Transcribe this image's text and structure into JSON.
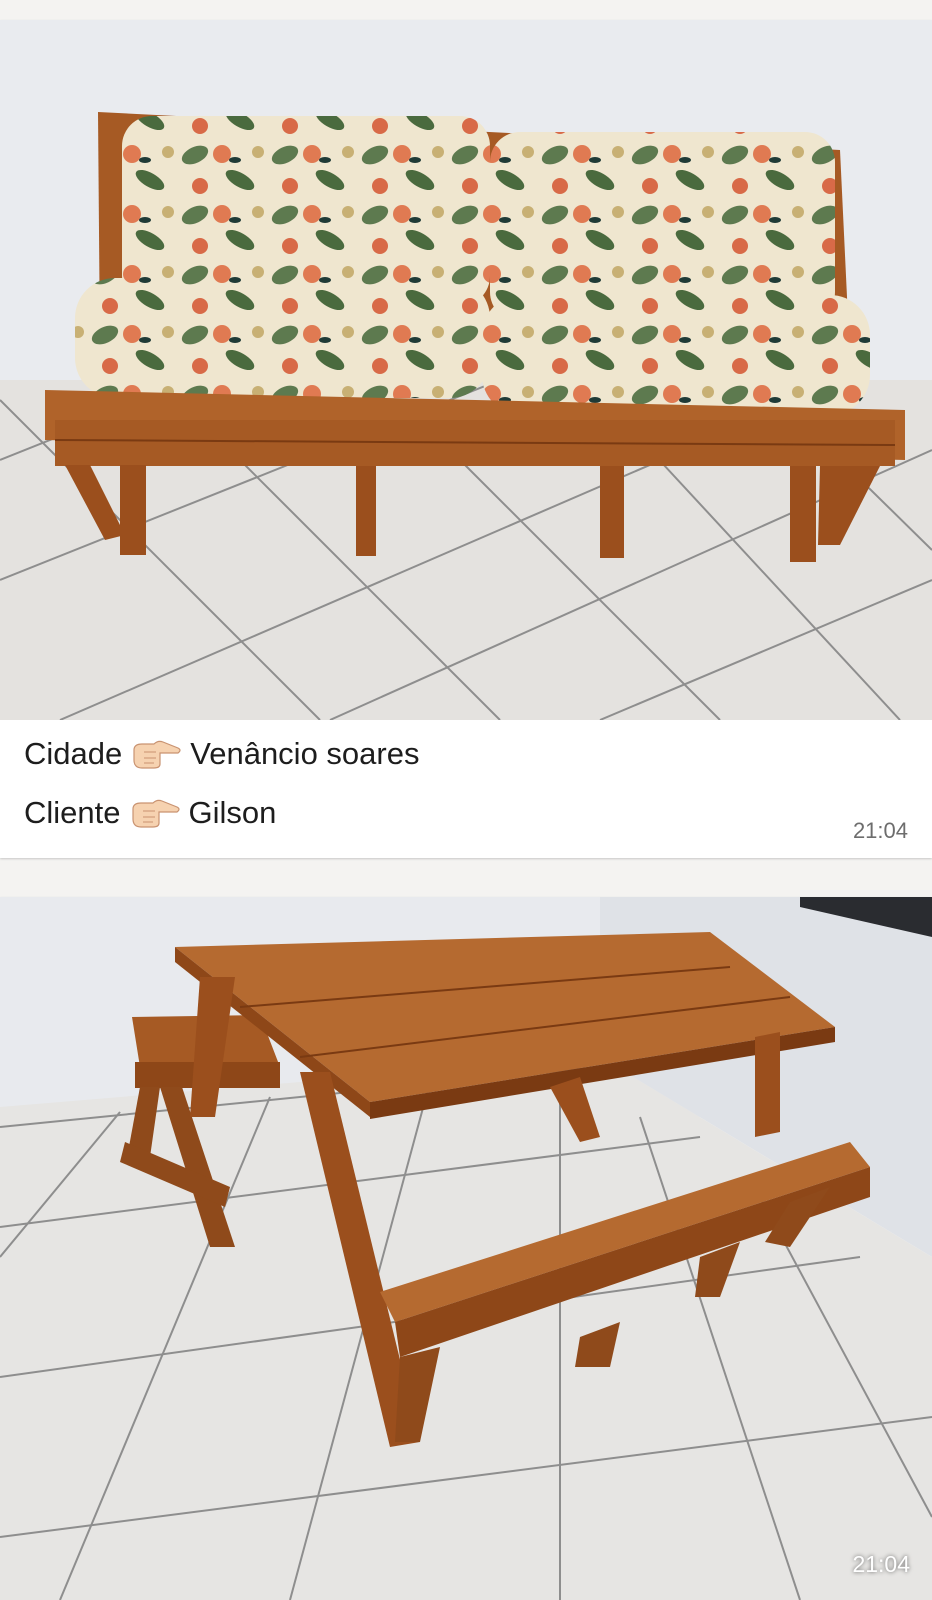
{
  "messages": [
    {
      "photo_alt": "wooden bench with floral cushions",
      "caption_lines": [
        {
          "label": "Cidade",
          "emoji": "pointing-right-hand",
          "value": "Venâncio soares"
        },
        {
          "label": "Cliente",
          "emoji": "pointing-right-hand",
          "value": "Gilson"
        }
      ],
      "time": "21:04"
    },
    {
      "photo_alt": "folding wooden picnic table with benches",
      "time": "21:04"
    }
  ],
  "colors": {
    "wood": "#a65a24",
    "wood_dark": "#7a3a12",
    "wall": "#e9ebef",
    "tile": "#e4e2df",
    "grout": "#8e8e8e",
    "cushion_green": "#5d7a4f",
    "cushion_orange": "#e07a52",
    "cushion_cream": "#efe6cf"
  }
}
